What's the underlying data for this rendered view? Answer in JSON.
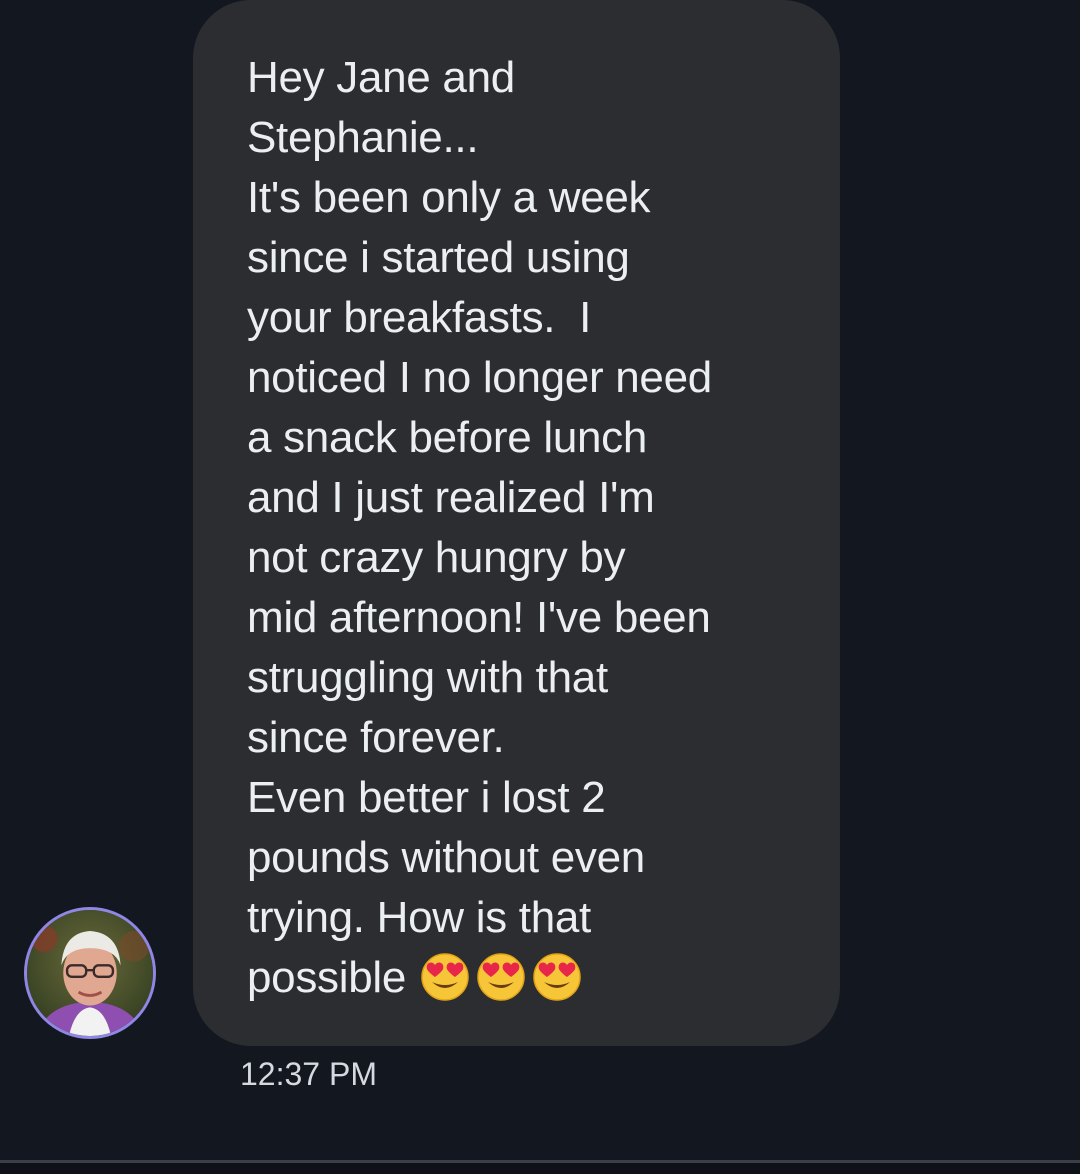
{
  "message": {
    "lines": [
      "Hey Jane and",
      "Stephanie...",
      "It's been only a week",
      "since i started using",
      "your breakfasts.  I",
      "noticed I no longer need",
      "a snack before lunch",
      "and I just realized I'm",
      "not crazy hungry by",
      "mid afternoon! I've been",
      "struggling with that",
      "since forever.",
      "Even better i lost 2",
      "pounds without even",
      "trying. How is that",
      "possible"
    ],
    "emojis": [
      "heart-eyes-emoji",
      "heart-eyes-emoji",
      "heart-eyes-emoji"
    ],
    "timestamp": "12:37 PM"
  },
  "sender": {
    "avatar_icon": "profile-photo-avatar"
  },
  "colors": {
    "background": "#121720",
    "bubble": "#2b2d31",
    "text": "#eceff2",
    "timestamp": "#d6d9de",
    "avatar_ring": "#8f86e6"
  }
}
